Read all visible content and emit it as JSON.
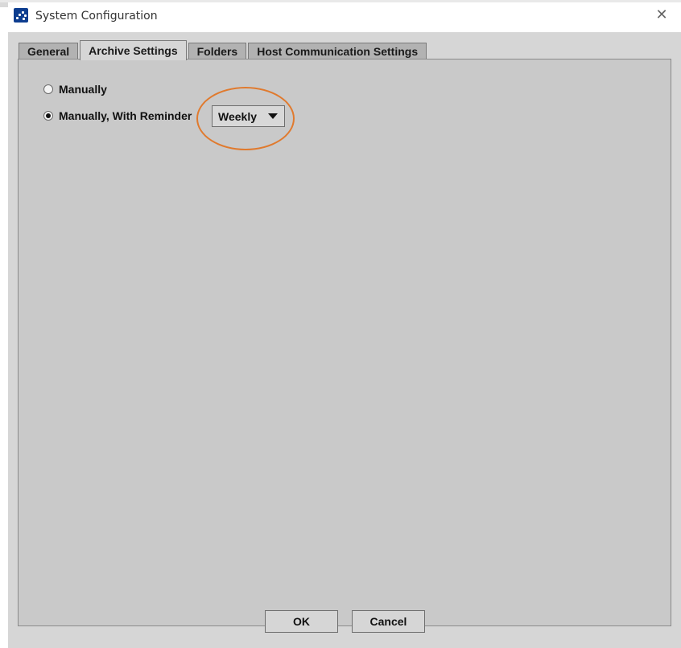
{
  "window": {
    "title": "System Configuration",
    "close_icon": "close-icon",
    "app_icon": "app-logo-icon"
  },
  "tabs": [
    {
      "label": "General",
      "active": false
    },
    {
      "label": "Archive Settings",
      "active": true
    },
    {
      "label": "Folders",
      "active": false
    },
    {
      "label": "Host Communication Settings",
      "active": false
    }
  ],
  "archive": {
    "options": [
      {
        "label": "Manually",
        "checked": false
      },
      {
        "label": "Manually, With Reminder",
        "checked": true
      }
    ],
    "reminder_dropdown": {
      "selected": "Weekly",
      "icon": "dropdown-arrow-icon"
    }
  },
  "buttons": {
    "ok": "OK",
    "cancel": "Cancel"
  },
  "colors": {
    "highlight": "#e07a2e",
    "app_icon": "#0d3d8f",
    "panel_bg": "#c9c9c9"
  }
}
